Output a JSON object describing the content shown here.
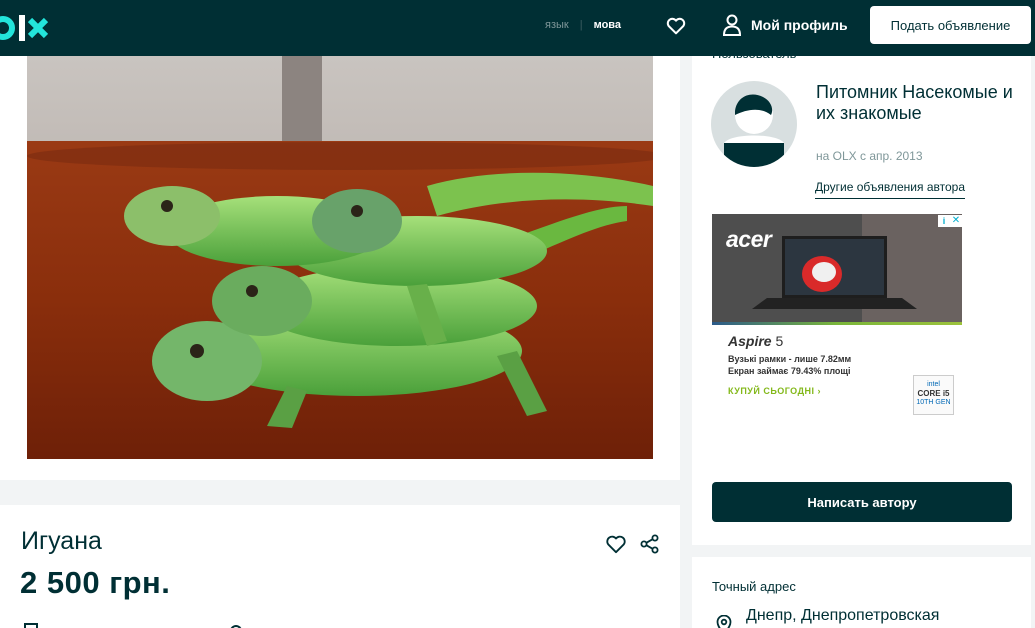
{
  "header": {
    "logo_text": "OLX",
    "lang_ru": "язык",
    "lang_separator": "|",
    "lang_ua": "мова",
    "favorites_icon": "heart-icon",
    "profile_icon": "user-icon",
    "profile_label": "Мой профиль",
    "post_ad_button": "Подать объявление",
    "colors": {
      "background": "#002f34",
      "accent": "#23e5db"
    }
  },
  "listing": {
    "title": "Игуана",
    "price": "2 500 грн.",
    "favorite_icon": "heart-icon",
    "share_icon": "share-icon"
  },
  "seller": {
    "section_label": "Пользователь",
    "name": "Питомник Насекомые и их знакомые",
    "member_since": "на OLX с апр. 2013",
    "other_ads_link": "Другие объявления автора",
    "write_button": "Написать автору"
  },
  "banner_ad": {
    "brand": "acer",
    "model_name": "Aspire",
    "model_number": "5",
    "line1": "Вузькі рамки - лише 7.82мм",
    "line2": "Екран займає 79.43% площі",
    "cta": "КУПУЙ СЬОГОДНІ ›",
    "badge_brand": "intel",
    "badge_line1": "CORE i5",
    "badge_line2": "10TH GEN",
    "info_icon": "info-icon",
    "close_icon": "close-icon"
  },
  "address": {
    "label": "Точный адрес",
    "city": "Днепр, Днепропетровская"
  }
}
